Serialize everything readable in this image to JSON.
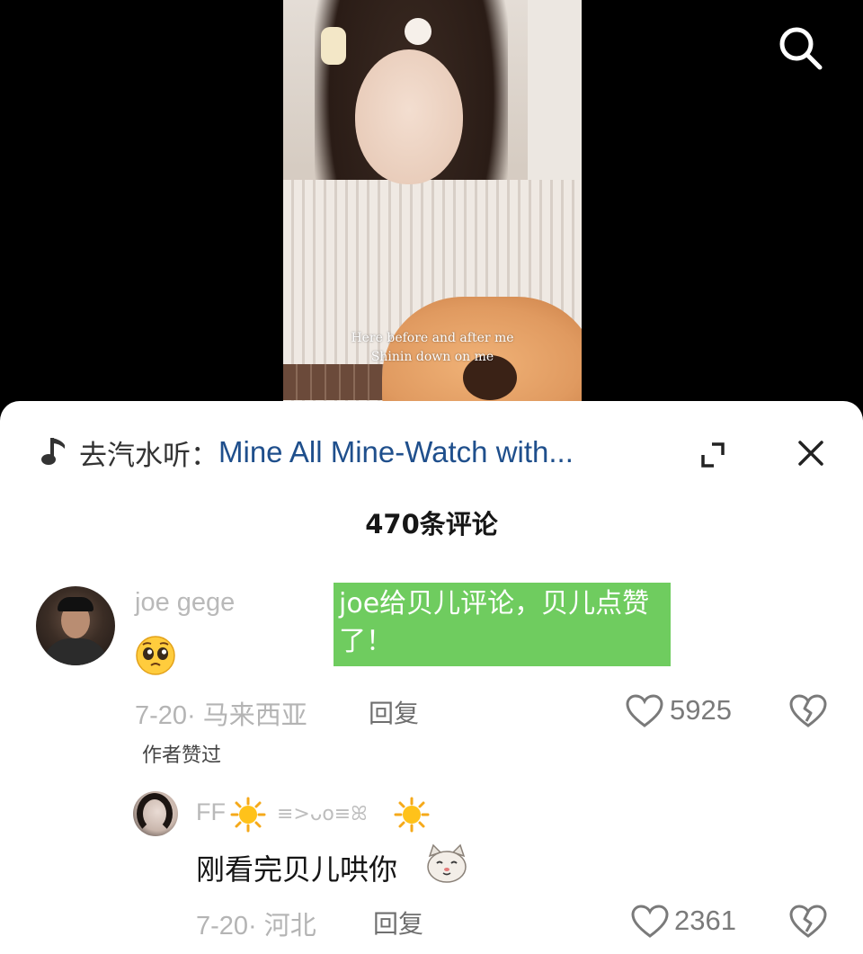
{
  "video": {
    "subtitle_line_1": "Here before and after me",
    "subtitle_line_2": "Shinin down on me"
  },
  "top_bar": {
    "search_icon": "search-icon"
  },
  "sheet": {
    "music_prefix": "去汽水听：",
    "music_title": "Mine All Mine-Watch with...",
    "comment_count": "470条评论"
  },
  "annotation": {
    "text": "joe给贝儿评论，贝儿点赞了！",
    "color": "#6fcc5f"
  },
  "comments": [
    {
      "username": "joe gege",
      "emoji": "pleading-face-emoji",
      "meta": "7-20· 马来西亚",
      "reply_label": "回复",
      "like_count": "5925",
      "author_liked": "作者赞过"
    },
    {
      "username": "FF",
      "kaomoji": "≡>ᴗo≡ꕤ",
      "content": "刚看完贝儿哄你",
      "emoji": "cat-face-emoji",
      "meta": "7-20· 河北",
      "reply_label": "回复",
      "like_count": "2361"
    }
  ],
  "colors": {
    "link_blue": "#1f4f8c",
    "muted_gray": "#b4b4b4",
    "sheet_bg": "#ffffff"
  }
}
